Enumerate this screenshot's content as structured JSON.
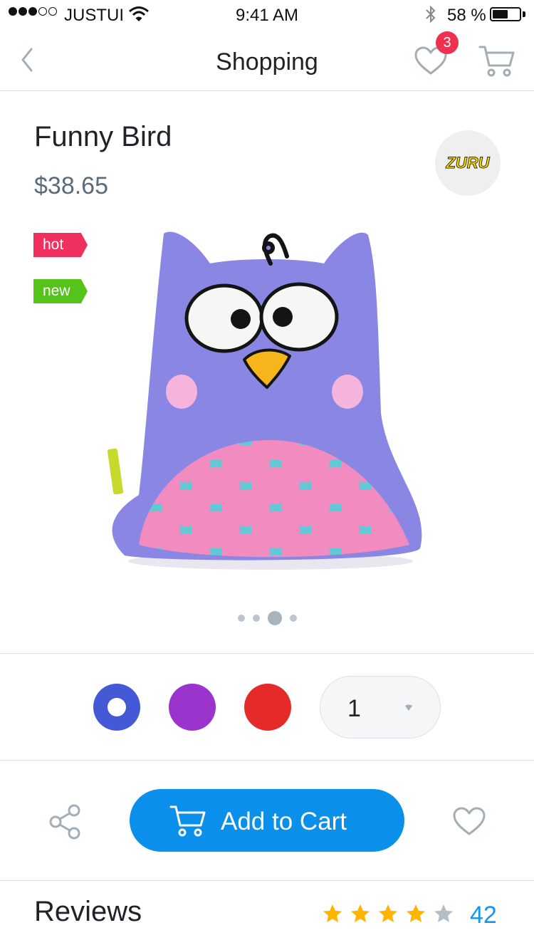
{
  "status_bar": {
    "carrier": "JUSTUI",
    "time": "9:41 AM",
    "battery": "58 %",
    "battery_level": 0.58
  },
  "nav": {
    "title": "Shopping",
    "favorites_badge": "3"
  },
  "product": {
    "name": "Funny Bird",
    "price": "$38.65",
    "brand": "ZURU",
    "tags": [
      "hot",
      "new"
    ],
    "image_count": 4,
    "image_index": 3
  },
  "options": {
    "colors": [
      "#4459d6",
      "#9a34cc",
      "#e52a2a"
    ],
    "selected_color_index": 0,
    "quantity": "1"
  },
  "actions": {
    "add_to_cart": "Add to Cart"
  },
  "reviews": {
    "title": "Reviews",
    "rating": 4,
    "rating_max": 5,
    "count": "42"
  },
  "colors": {
    "accent": "#0a8fea",
    "badge": "#f0304e",
    "tag_hot": "#f0305e",
    "tag_new": "#55c31a",
    "star_on": "#ffb400",
    "star_off": "#b5bec6"
  },
  "icons": [
    "back-chevron-icon",
    "heart-icon",
    "cart-icon",
    "share-icon",
    "star-icon",
    "wifi-icon",
    "bluetooth-icon",
    "battery-icon",
    "signal-icon",
    "dropdown-caret-icon"
  ]
}
